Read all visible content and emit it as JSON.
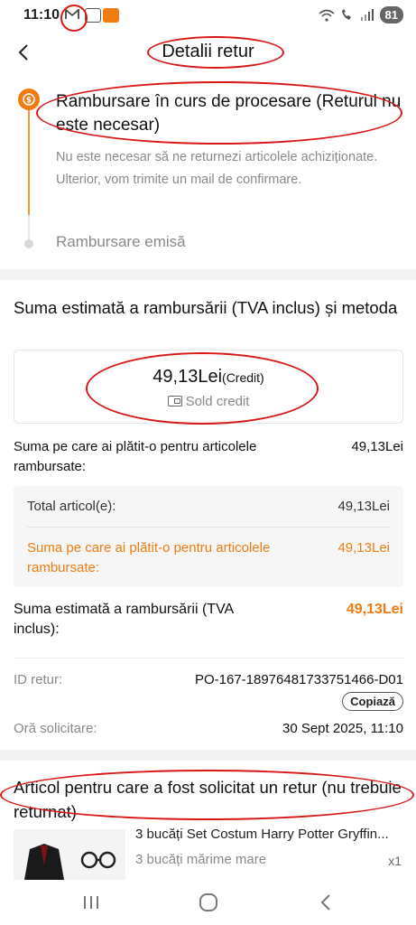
{
  "status_bar": {
    "time": "11:10",
    "battery": "81",
    "icons": [
      "gmail-icon",
      "screenshot-icon",
      "app-notification-icon",
      "wifi-icon",
      "call-icon",
      "signal-icon"
    ]
  },
  "header": {
    "title": "Detalii retur",
    "back_icon": "chevron-left-icon"
  },
  "status": {
    "current_step_title": "Rambursare în curs de procesare (Returul nu este necesar)",
    "current_step_description": "Nu este necesar să ne returnezi articolele achiziționate. Ulterior, vom trimite un mail de confirmare.",
    "next_step_label": "Rambursare emisă"
  },
  "refund": {
    "section_title": "Suma estimată a rambursării (TVA inclus) și metoda",
    "credit_amount": "49,13Lei",
    "credit_tag": "(Credit)",
    "method_label": "Sold credit",
    "paid_for_items_label": "Suma pe care ai plătit-o pentru articolele rambursate:",
    "paid_for_items_value": "49,13Lei",
    "breakdown": {
      "total_items_label": "Total articol(e):",
      "total_items_value": "49,13Lei",
      "paid_label": "Suma pe care ai plătit-o pentru articolele rambursate:",
      "paid_value": "49,13Lei"
    },
    "estimated_label": "Suma estimată a rambursării (TVA inclus):",
    "estimated_value": "49,13Lei",
    "return_id_label": "ID retur:",
    "return_id_value": "PO-167-18976481733751466-D01",
    "copy_label": "Copiază",
    "request_time_label": "Oră solicitare:",
    "request_time_value": "30 Sept 2025, 11:10"
  },
  "items": {
    "section_title": "Articol pentru care a fost solicitat un retur (nu trebuie returnat)",
    "list": [
      {
        "name": "3 bucăți Set Costum Harry Potter Gryffin...",
        "variant": "3 bucăți mărime mare",
        "quantity": "x1"
      }
    ]
  },
  "nav_bar": {
    "buttons": [
      "recent-apps-icon",
      "home-icon",
      "back-nav-icon"
    ]
  },
  "colors": {
    "accent": "#f07c11",
    "annotation": "#d81818",
    "muted_text": "#8a8a8a"
  }
}
